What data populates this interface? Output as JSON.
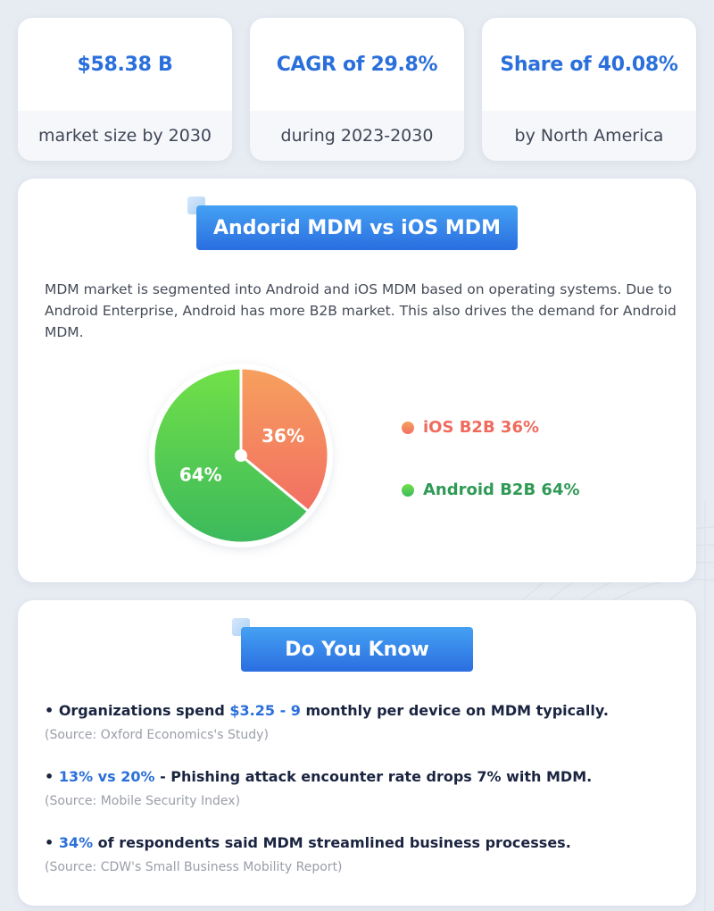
{
  "stats": [
    {
      "value": "$58.38 B",
      "label": "market size by 2030"
    },
    {
      "value": "CAGR of 29.8%",
      "label": "during 2023-2030"
    },
    {
      "value": "Share of 40.08%",
      "label": "by North America"
    }
  ],
  "comparison": {
    "title": "Andorid MDM vs iOS MDM",
    "description": "MDM market is segmented into Android and iOS MDM based on operating systems. Due to Android Enterprise, Android has more B2B market. This also drives the demand for Android MDM."
  },
  "chart_data": {
    "type": "pie",
    "title": "Andorid MDM vs iOS MDM",
    "slices": [
      {
        "name": "iOS B2B",
        "value": 36,
        "label": "36%",
        "legend": "iOS B2B 36%",
        "color_top": "#f6a05e",
        "color_bottom": "#f26f62",
        "legend_color": "#ef6b5e"
      },
      {
        "name": "Android B2B",
        "value": 64,
        "label": "64%",
        "legend": "Android B2B 64%",
        "color_top": "#72e048",
        "color_bottom": "#3bb95c",
        "legend_color": "#2f9a55"
      }
    ],
    "legend_position": "right"
  },
  "facts": {
    "title": "Do You Know",
    "items": [
      {
        "pre": "Organizations spend ",
        "highlight": "$3.25 - 9",
        "post": " monthly per device on MDM typically.",
        "source": "(Source: Oxford Economics's Study)"
      },
      {
        "pre": "",
        "highlight": "13% vs 20%",
        "post": " - Phishing attack encounter rate drops 7% with MDM.",
        "source": "(Source: Mobile Security Index)"
      },
      {
        "pre": "",
        "highlight": "34%",
        "post": " of respondents said MDM streamlined business processes.",
        "source": "(Source: CDW's Small Business Mobility Report)"
      }
    ],
    "bullet": "•"
  }
}
